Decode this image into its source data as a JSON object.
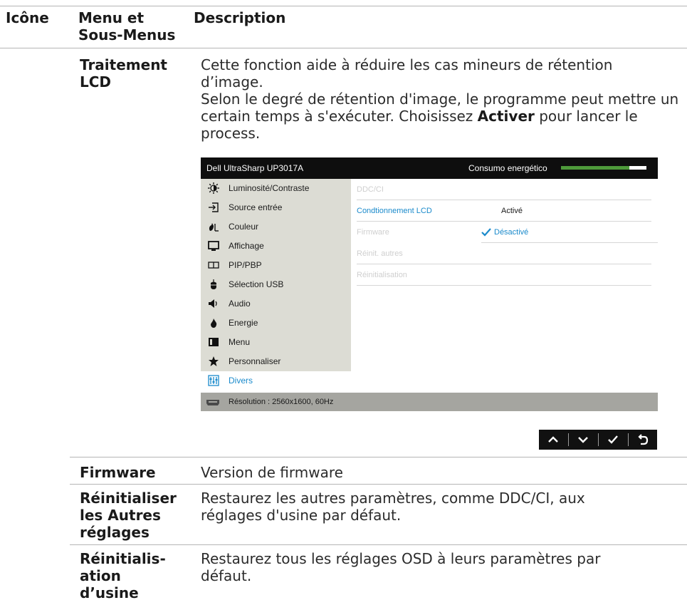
{
  "table": {
    "headers": {
      "icon": "Icône",
      "menu": "Menu et Sous-Menus",
      "description": "Description"
    }
  },
  "rows": {
    "lcd": {
      "label": "Traitement LCD",
      "desc_line1": "Cette fonction aide à réduire les cas mineurs de rétention d’image.",
      "desc_line2_pre": "Selon le degré de rétention d'image, le programme peut mettre un certain temps à s'exécuter. Choisissez ",
      "desc_line2_bold": "Activer",
      "desc_line2_post": " pour lancer le process."
    },
    "firmware": {
      "label": "Firmware",
      "desc": "Version de firmware"
    },
    "reset_other": {
      "label": "Réinitialiser les Autres réglages",
      "desc": "Restaurez les autres paramètres, comme DDC/CI, aux réglages d'usine par défaut."
    },
    "factory_reset": {
      "label": "Réinitialis-ation d’usine",
      "desc": "Restaurez tous les réglages OSD à leurs paramètres par défaut."
    }
  },
  "osd": {
    "model": "Dell UltraSharp UP3017A",
    "power_label": "Consumo energético",
    "power_level_percent": 80,
    "colors": {
      "accent": "#1a8acb",
      "power_bar": "#4e9a3b",
      "menu_bg": "#dcdcd4",
      "status_bg": "#a5a5a0"
    },
    "menu": [
      {
        "label": "Luminosité/Contraste",
        "icon": "brightness-icon"
      },
      {
        "label": "Source entrée",
        "icon": "input-source-icon"
      },
      {
        "label": "Couleur",
        "icon": "color-icon"
      },
      {
        "label": "Affichage",
        "icon": "display-icon"
      },
      {
        "label": "PIP/PBP",
        "icon": "pip-pbp-icon"
      },
      {
        "label": "Sélection USB",
        "icon": "usb-mouse-icon"
      },
      {
        "label": "Audio",
        "icon": "speaker-icon"
      },
      {
        "label": "Energie",
        "icon": "energy-icon"
      },
      {
        "label": "Menu",
        "icon": "menu-icon"
      },
      {
        "label": "Personnaliser",
        "icon": "star-icon"
      },
      {
        "label": "Divers",
        "icon": "others-icon",
        "selected": true
      }
    ],
    "options": [
      {
        "label": "DDC/CI"
      },
      {
        "label": "Condtionnement LCD",
        "active": true,
        "value": "Activé"
      },
      {
        "label": "Firmware",
        "value": "Désactivé",
        "checked": true
      },
      {
        "label": "Réinit. autres"
      },
      {
        "label": "Réinitialisation"
      }
    ],
    "status": "Résolution : 2560x1600, 60Hz",
    "nav_buttons": [
      "up-arrow-icon",
      "down-arrow-icon",
      "check-icon",
      "back-icon"
    ]
  }
}
